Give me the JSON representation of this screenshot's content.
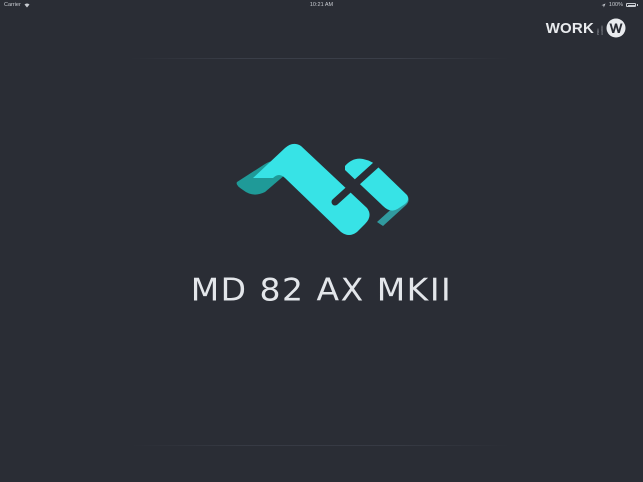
{
  "status_bar": {
    "carrier": "Carrier",
    "time": "10:21 AM",
    "battery": "100%"
  },
  "brand": {
    "name": "WORK",
    "subtext": "PRO AUDIO",
    "mark_icon": "w-circle-icon"
  },
  "main": {
    "logo_icon": "fold-ribbon-logo-icon",
    "product_title": "MD 82 AX MKII"
  },
  "colors": {
    "background": "#2a2d35",
    "accent_light": "#37e3e6",
    "accent_dark": "#1f9a98",
    "text": "#e3e6ea"
  }
}
